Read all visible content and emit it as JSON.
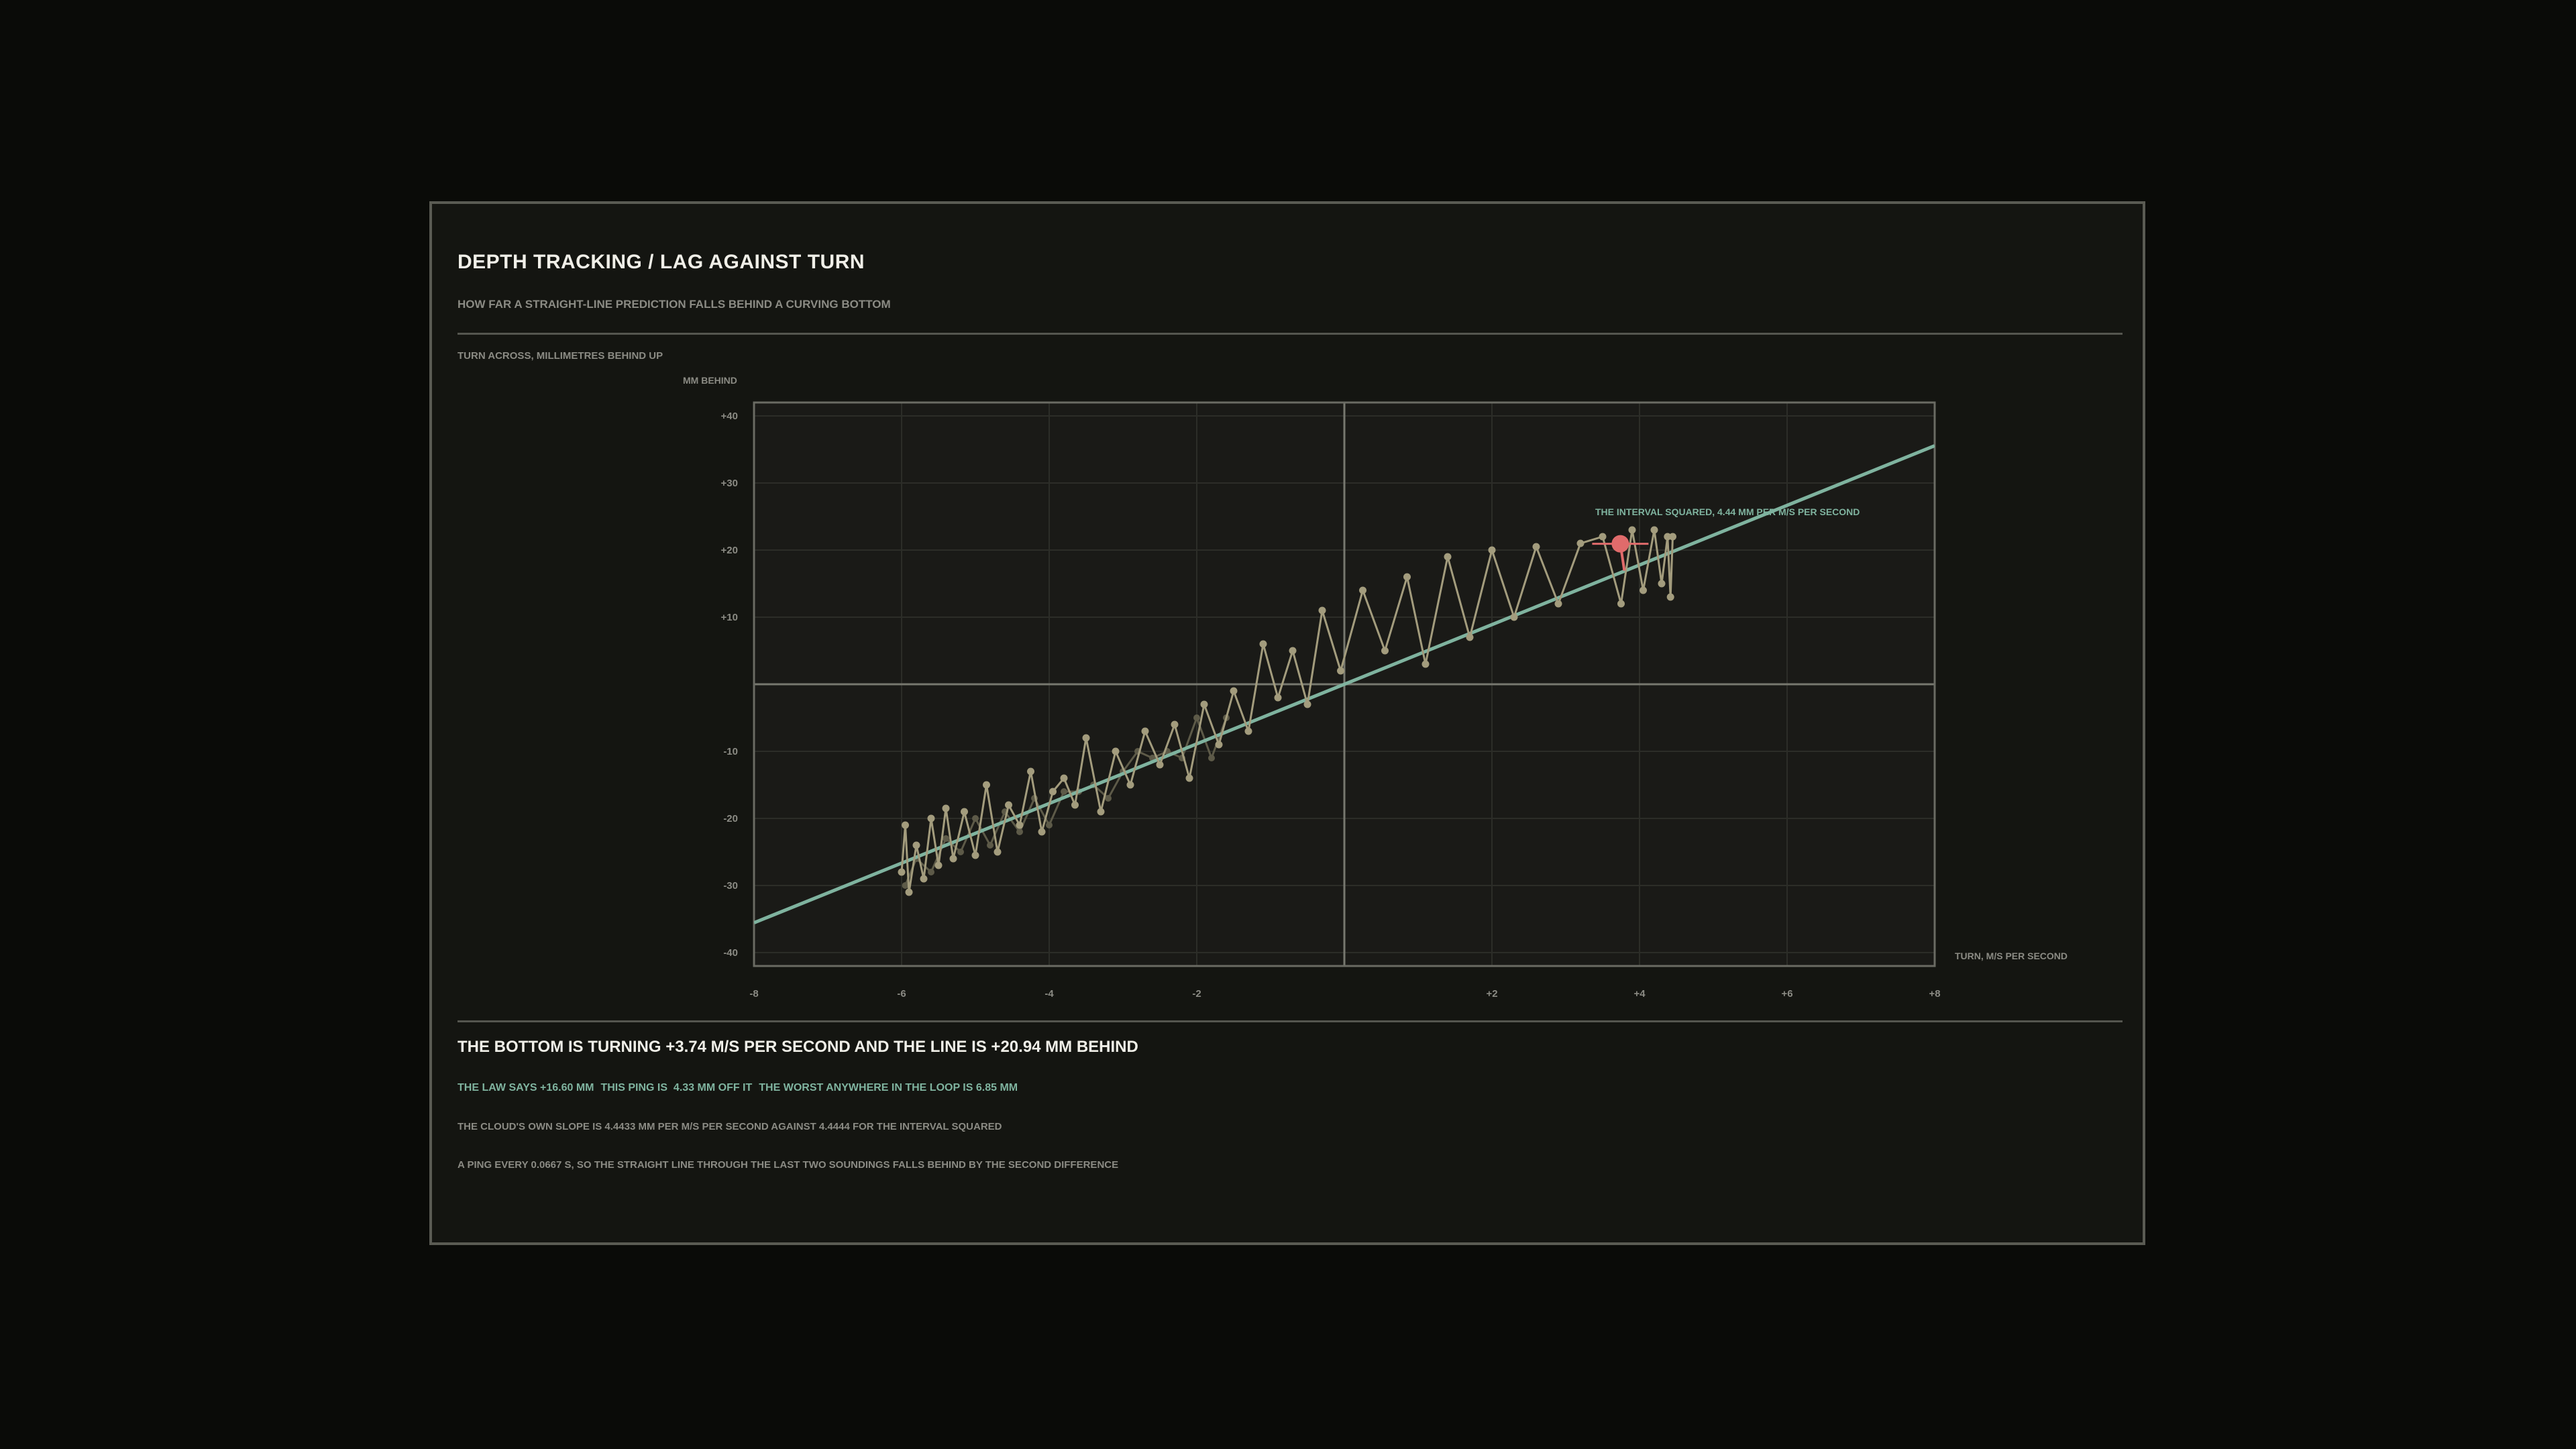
{
  "title": "DEPTH TRACKING / LAG AGAINST TURN",
  "subtitle": "HOW FAR A STRAIGHT-LINE PREDICTION FALLS BEHIND A CURVING BOTTOM",
  "axes_note": "TURN ACROSS, MILLIMETRES BEHIND UP",
  "headline": "THE BOTTOM IS TURNING +3.74 M/S PER SECOND AND THE LINE IS +20.94 MM BEHIND",
  "stats": {
    "law": "THE LAW SAYS +16.60 MM",
    "ping": "THIS PING IS  4.33 MM OFF IT",
    "worst": "THE WORST ANYWHERE IN THE LOOP IS 6.85 MM"
  },
  "slope_note": "THE CLOUD'S OWN SLOPE IS 4.4433 MM PER M/S PER SECOND AGAINST 4.4444 FOR THE INTERVAL SQUARED",
  "ping_note": "A PING EVERY 0.0667 S, SO THE STRAIGHT LINE THROUGH THE LAST TWO SOUNDINGS FALLS BEHIND BY THE SECOND DIFFERENCE",
  "colors": {
    "law_line": "#7fb39f",
    "trace": "#a39c7d",
    "current": "#e06b6b",
    "background": "#141511"
  },
  "chart_data": {
    "type": "scatter",
    "xlabel": "TURN, M/S PER SECOND",
    "ylabel": "MM BEHIND",
    "xlim": [
      -8,
      8
    ],
    "ylim": [
      -42,
      42
    ],
    "x_ticks": [
      "-8",
      "-6",
      "-4",
      "-2",
      "+2",
      "+4",
      "+6",
      "+8"
    ],
    "x_tick_values": [
      -8,
      -6,
      -4,
      -2,
      2,
      4,
      6,
      8
    ],
    "y_ticks": [
      "+40",
      "+30",
      "+20",
      "+10",
      "-10",
      "-20",
      "-30",
      "-40"
    ],
    "y_tick_values": [
      40,
      30,
      20,
      10,
      -10,
      -20,
      -30,
      -40
    ],
    "grid": true,
    "law_line": {
      "name": "THE INTERVAL SQUARED, 4.44 MM PER M/S PER SECOND",
      "slope": 4.4444,
      "intercept": 0
    },
    "current_point": {
      "x": 3.74,
      "y": 20.94
    },
    "trace": {
      "x": [
        -6.0,
        -5.95,
        -5.9,
        -5.8,
        -5.7,
        -5.6,
        -5.5,
        -5.4,
        -5.3,
        -5.15,
        -5.0,
        -4.85,
        -4.7,
        -4.55,
        -4.4,
        -4.25,
        -4.1,
        -3.95,
        -3.8,
        -3.65,
        -3.5,
        -3.3,
        -3.1,
        -2.9,
        -2.7,
        -2.5,
        -2.3,
        -2.1,
        -1.9,
        -1.7,
        -1.5,
        -1.3,
        -1.1,
        -0.9,
        -0.7,
        -0.5,
        -0.3,
        -0.05,
        0.25,
        0.55,
        0.85,
        1.1,
        1.4,
        1.7,
        2.0,
        2.3,
        2.6,
        2.9,
        3.2,
        3.5,
        3.75,
        3.9,
        4.05,
        4.2,
        4.3,
        4.38,
        4.42,
        4.45
      ],
      "y": [
        -28,
        -21,
        -31,
        -24,
        -29,
        -20,
        -27,
        -18.5,
        -26,
        -19,
        -25.5,
        -15,
        -25,
        -18,
        -21,
        -13,
        -22,
        -16,
        -14,
        -18,
        -8,
        -19,
        -10,
        -15,
        -7,
        -12,
        -6,
        -14,
        -3,
        -9,
        -1,
        -7,
        6,
        -2,
        5,
        -3,
        11,
        2,
        14,
        5,
        16,
        3,
        19,
        7,
        20,
        10,
        20.5,
        12,
        21,
        22,
        12,
        23,
        14,
        23,
        15,
        22,
        13,
        22
      ]
    },
    "ghost_trace": {
      "x": [
        -5.95,
        -5.8,
        -5.6,
        -5.4,
        -5.2,
        -5.0,
        -4.8,
        -4.6,
        -4.4,
        -4.2,
        -4.0,
        -3.8,
        -3.6,
        -3.4,
        -3.2,
        -3.0,
        -2.8,
        -2.6,
        -2.4,
        -2.2,
        -2.0,
        -1.8,
        -1.6
      ],
      "y": [
        -30,
        -26,
        -28,
        -23,
        -25,
        -20,
        -24,
        -19,
        -22,
        -17,
        -21,
        -16,
        -16,
        -15,
        -17,
        -13,
        -10,
        -11,
        -10,
        -11,
        -5,
        -11,
        -5
      ]
    }
  }
}
